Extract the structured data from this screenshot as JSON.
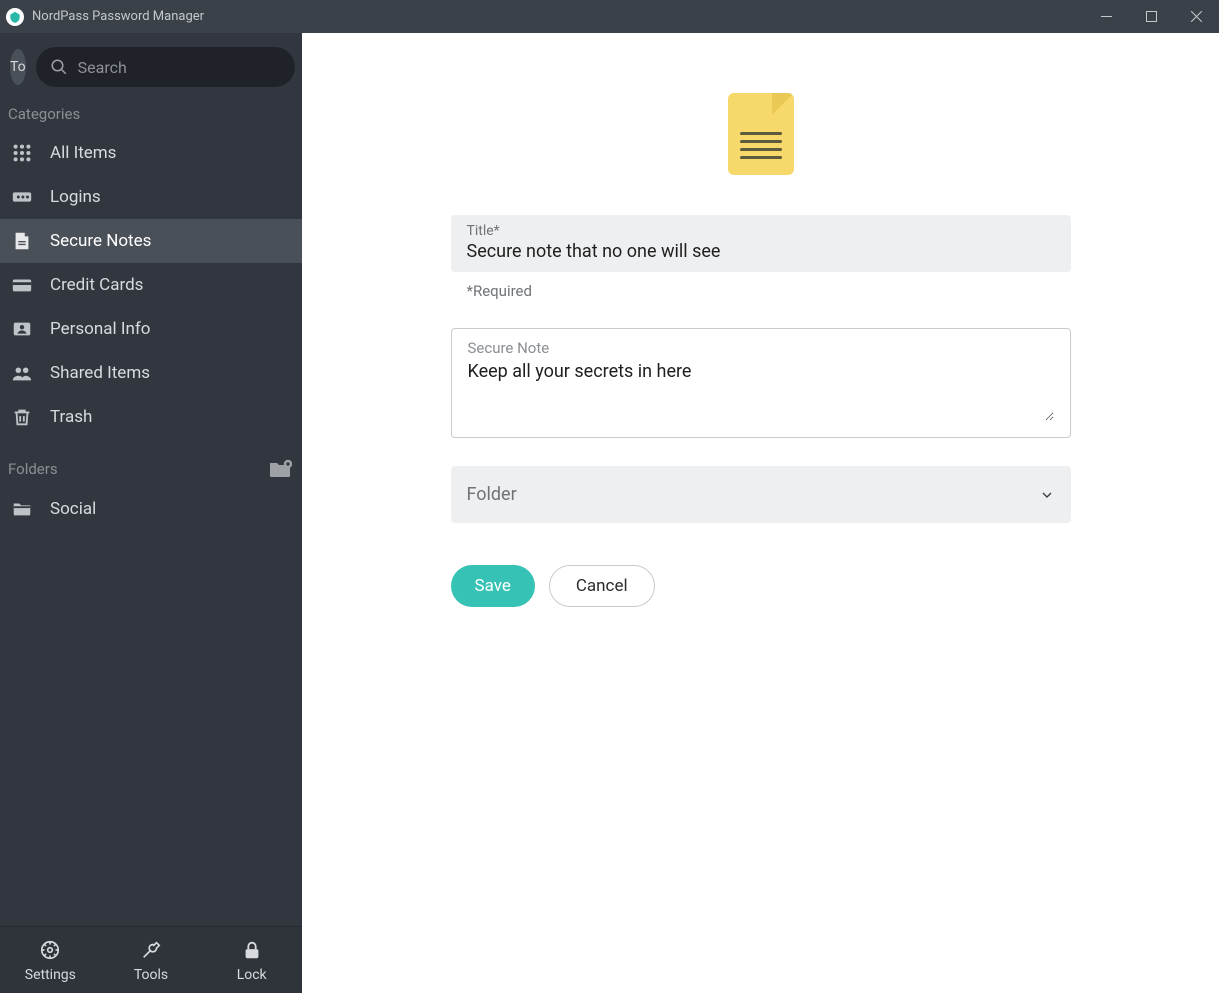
{
  "window": {
    "title": "NordPass Password Manager"
  },
  "sidebar": {
    "avatar_initials": "To",
    "search_placeholder": "Search",
    "categories_label": "Categories",
    "items": [
      {
        "label": "All Items"
      },
      {
        "label": "Logins"
      },
      {
        "label": "Secure Notes"
      },
      {
        "label": "Credit Cards"
      },
      {
        "label": "Personal Info"
      },
      {
        "label": "Shared Items"
      },
      {
        "label": "Trash"
      }
    ],
    "folders_label": "Folders",
    "folders": [
      {
        "label": "Social"
      }
    ]
  },
  "bottom": {
    "settings": "Settings",
    "tools": "Tools",
    "lock": "Lock"
  },
  "form": {
    "title_label": "Title*",
    "title_value": "Secure note that no one will see",
    "required_text": "*Required",
    "note_label": "Secure Note",
    "note_value": "Keep all your secrets in here",
    "folder_label": "Folder",
    "save": "Save",
    "cancel": "Cancel"
  }
}
